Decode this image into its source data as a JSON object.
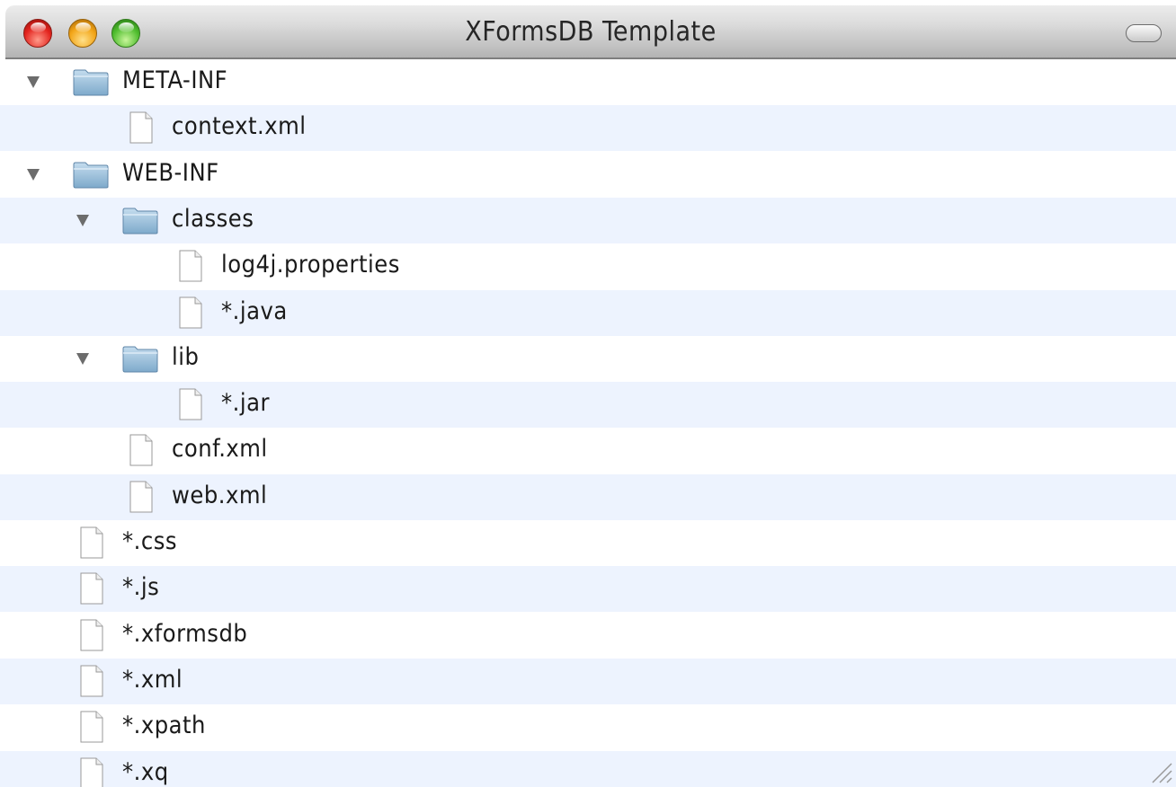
{
  "window": {
    "title": "XFormsDB Template"
  },
  "tree": {
    "items": [
      {
        "name": "META-INF",
        "kind": "folder",
        "expanded": true,
        "depth": 0
      },
      {
        "name": "context.xml",
        "kind": "file",
        "depth": 1
      },
      {
        "name": "WEB-INF",
        "kind": "folder",
        "expanded": true,
        "depth": 0
      },
      {
        "name": "classes",
        "kind": "folder",
        "expanded": true,
        "depth": 1
      },
      {
        "name": "log4j.properties",
        "kind": "file",
        "depth": 2
      },
      {
        "name": "*.java",
        "kind": "file",
        "depth": 2
      },
      {
        "name": "lib",
        "kind": "folder",
        "expanded": true,
        "depth": 1
      },
      {
        "name": "*.jar",
        "kind": "file",
        "depth": 2
      },
      {
        "name": "conf.xml",
        "kind": "file",
        "depth": 1
      },
      {
        "name": "web.xml",
        "kind": "file",
        "depth": 1
      },
      {
        "name": "*.css",
        "kind": "file",
        "depth": 0
      },
      {
        "name": "*.js",
        "kind": "file",
        "depth": 0
      },
      {
        "name": "*.xformsdb",
        "kind": "file",
        "depth": 0
      },
      {
        "name": "*.xml",
        "kind": "file",
        "depth": 0
      },
      {
        "name": "*.xpath",
        "kind": "file",
        "depth": 0
      },
      {
        "name": "*.xq",
        "kind": "file",
        "depth": 0
      }
    ]
  },
  "icons": {
    "folder": "folder-icon",
    "file": "file-icon",
    "disclosure": "disclosure-triangle-icon"
  },
  "colors": {
    "row_alternate": "#edf3fe",
    "folder_blue": "#9cc1de"
  }
}
